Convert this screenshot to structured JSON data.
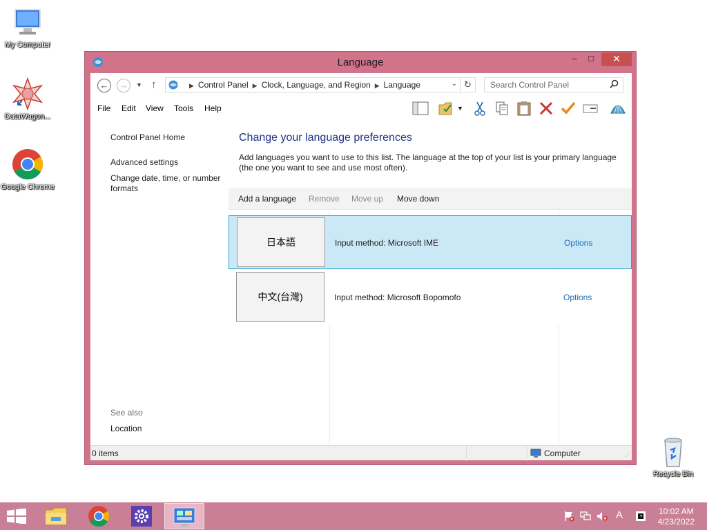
{
  "desktop": {
    "icons": [
      {
        "label": "My Computer"
      },
      {
        "label": "DataWagon..."
      },
      {
        "label": "Google Chrome"
      },
      {
        "label": "Recycle Bin"
      }
    ]
  },
  "window": {
    "title": "Language",
    "controls": {
      "minimize": "–",
      "maximize": "□",
      "close": "✕"
    },
    "breadcrumbs": [
      "Control Panel",
      "Clock, Language, and Region",
      "Language"
    ],
    "search_placeholder": "Search Control Panel",
    "menu": [
      "File",
      "Edit",
      "View",
      "Tools",
      "Help"
    ]
  },
  "left_pane": {
    "links": [
      "Control Panel Home",
      "Advanced settings",
      "Change date, time, or number formats"
    ],
    "see_also_label": "See also",
    "see_also_links": [
      "Location"
    ]
  },
  "main": {
    "heading": "Change your language preferences",
    "description": "Add languages you want to use to this list. The language at the top of your list is your primary language (the one you want to see and use most often).",
    "commands": [
      {
        "label": "Add a language",
        "enabled": true
      },
      {
        "label": "Remove",
        "enabled": false
      },
      {
        "label": "Move up",
        "enabled": false
      },
      {
        "label": "Move down",
        "enabled": true
      }
    ],
    "languages": [
      {
        "name": "日本語",
        "input_method": "Input method: Microsoft IME",
        "options": "Options",
        "selected": true
      },
      {
        "name": "中文(台灣)",
        "input_method": "Input method: Microsoft Bopomofo",
        "options": "Options",
        "selected": false
      }
    ]
  },
  "status_bar": {
    "items": "0 items",
    "zone": "Computer"
  },
  "taskbar": {
    "clock_time": "10:02 AM",
    "clock_date": "4/23/2022"
  },
  "colors": {
    "window_frame": "#d2738c",
    "taskbar": "#c97f96",
    "selection": "#cbe8f6",
    "link": "#1e6eb4",
    "heading": "#1e3287"
  }
}
